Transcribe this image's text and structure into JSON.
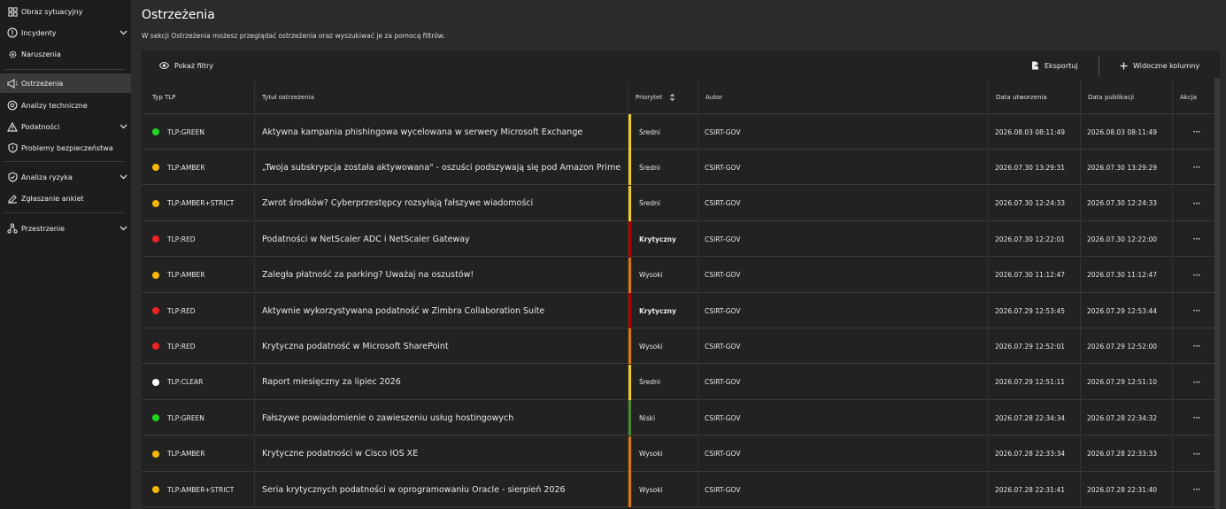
{
  "sidebar": {
    "items": [
      {
        "label": "Obraz sytuacyjny",
        "icon": "dashboard-icon",
        "chevron": false,
        "active": false
      },
      {
        "label": "Incydenty",
        "icon": "alert-circle-icon",
        "chevron": true,
        "active": false
      },
      {
        "label": "Naruszenia",
        "icon": "gear-icon",
        "chevron": false,
        "active": false
      },
      {
        "label": "Ostrzeżenia",
        "icon": "megaphone-icon",
        "chevron": false,
        "active": true
      },
      {
        "label": "Analizy techniczne",
        "icon": "search-analysis-icon",
        "chevron": false,
        "active": false
      },
      {
        "label": "Podatności",
        "icon": "warning-triangle-icon",
        "chevron": true,
        "active": false
      },
      {
        "label": "Problemy bezpieczeństwa",
        "icon": "shield-icon",
        "chevron": false,
        "active": false
      },
      {
        "label": "Analiza ryzyka",
        "icon": "shield-check-icon",
        "chevron": true,
        "active": false
      },
      {
        "label": "Zgłaszanie ankiet",
        "icon": "survey-icon",
        "chevron": false,
        "active": false
      },
      {
        "label": "Przestrzenie",
        "icon": "network-icon",
        "chevron": true,
        "active": false
      }
    ]
  },
  "page": {
    "title": "Ostrzeżenia",
    "description": "W sekcji Ostrzeżenia możesz przeglądać ostrzeżenia oraz wyszukiwać je za pomocą filtrów."
  },
  "toolbar": {
    "show_filters": "Pokaż filtry",
    "export": "Eksportuj",
    "visible_columns": "Widoczne kolumny"
  },
  "table": {
    "headers": {
      "tlp": "Typ TLP",
      "title": "Tytuł ostrzeżenia",
      "priority": "Priorytet",
      "author": "Autor",
      "created": "Data utworzenia",
      "published": "Data publikacji",
      "action": "Akcja"
    },
    "action_label": "···",
    "rows": [
      {
        "tlp": "TLP:GREEN",
        "tlp_color": "#22d422",
        "title": "Aktywna kampania phishingowa wycelowana w serwery Microsoft Exchange",
        "priority": "Średni",
        "priority_color": "#f5d020",
        "priority_bold": false,
        "author": "CSIRT-GOV",
        "created": "2026.08.03 08:11:49",
        "published": "2026.08.03 08:11:49"
      },
      {
        "tlp": "TLP:AMBER",
        "tlp_color": "#f5b800",
        "title": "„Twoja subskrypcja została aktywowana\" - oszuści podszywają się pod Amazon Prime",
        "priority": "Średni",
        "priority_color": "#f5d020",
        "priority_bold": false,
        "author": "CSIRT-GOV",
        "created": "2026.07.30 13:29:31",
        "published": "2026.07.30 13:29:29"
      },
      {
        "tlp": "TLP:AMBER+STRICT",
        "tlp_color": "#f5b800",
        "title": "Zwrot środków? Cyberprzestępcy rozsyłają fałszywe wiadomości",
        "priority": "Średni",
        "priority_color": "#f5d020",
        "priority_bold": false,
        "author": "CSIRT-GOV",
        "created": "2026.07.30 12:24:33",
        "published": "2026.07.30 12:24:33"
      },
      {
        "tlp": "TLP:RED",
        "tlp_color": "#ee2222",
        "title": "Podatności w NetScaler ADC i NetScaler Gateway",
        "priority": "Krytyczny",
        "priority_color": "#b00000",
        "priority_bold": true,
        "author": "CSIRT-GOV",
        "created": "2026.07.30 12:22:01",
        "published": "2026.07.30 12:22:00"
      },
      {
        "tlp": "TLP:AMBER",
        "tlp_color": "#f5b800",
        "title": "Zaległa płatność za parking? Uważaj na oszustów!",
        "priority": "Wysoki",
        "priority_color": "#e07800",
        "priority_bold": false,
        "author": "CSIRT-GOV",
        "created": "2026.07.30 11:12:47",
        "published": "2026.07.30 11:12:47"
      },
      {
        "tlp": "TLP:RED",
        "tlp_color": "#ee2222",
        "title": "Aktywnie wykorzystywana podatność w Zimbra Collaboration Suite",
        "priority": "Krytyczny",
        "priority_color": "#b00000",
        "priority_bold": true,
        "author": "CSIRT-GOV",
        "created": "2026.07.29 12:53:45",
        "published": "2026.07.29 12:53:44"
      },
      {
        "tlp": "TLP:RED",
        "tlp_color": "#ee2222",
        "title": "Krytyczna podatność w Microsoft SharePoint",
        "priority": "Wysoki",
        "priority_color": "#e07800",
        "priority_bold": false,
        "author": "CSIRT-GOV",
        "created": "2026.07.29 12:52:01",
        "published": "2026.07.29 12:52:00"
      },
      {
        "tlp": "TLP:CLEAR",
        "tlp_color": "#ffffff",
        "title": "Raport miesięczny za lipiec 2026",
        "priority": "Średni",
        "priority_color": "#f5d020",
        "priority_bold": false,
        "author": "CSIRT-GOV",
        "created": "2026.07.29 12:51:11",
        "published": "2026.07.29 12:51:10"
      },
      {
        "tlp": "TLP:GREEN",
        "tlp_color": "#22d422",
        "title": "Fałszywe powiadomienie o zawieszeniu usług hostingowych",
        "priority": "Niski",
        "priority_color": "#4a8a2a",
        "priority_bold": false,
        "author": "CSIRT-GOV",
        "created": "2026.07.28 22:34:34",
        "published": "2026.07.28 22:34:32"
      },
      {
        "tlp": "TLP:AMBER",
        "tlp_color": "#f5b800",
        "title": "Krytyczne podatności w Cisco IOS XE",
        "priority": "Wysoki",
        "priority_color": "#e07800",
        "priority_bold": false,
        "author": "CSIRT-GOV",
        "created": "2026.07.28 22:33:34",
        "published": "2026.07.28 22:33:33"
      },
      {
        "tlp": "TLP:AMBER+STRICT",
        "tlp_color": "#f5b800",
        "title": "Seria krytycznych podatności w oprogramowaniu Oracle - sierpień 2026",
        "priority": "Wysoki",
        "priority_color": "#e07800",
        "priority_bold": false,
        "author": "CSIRT-GOV",
        "created": "2026.07.28 22:31:41",
        "published": "2026.07.28 22:31:40"
      }
    ]
  }
}
